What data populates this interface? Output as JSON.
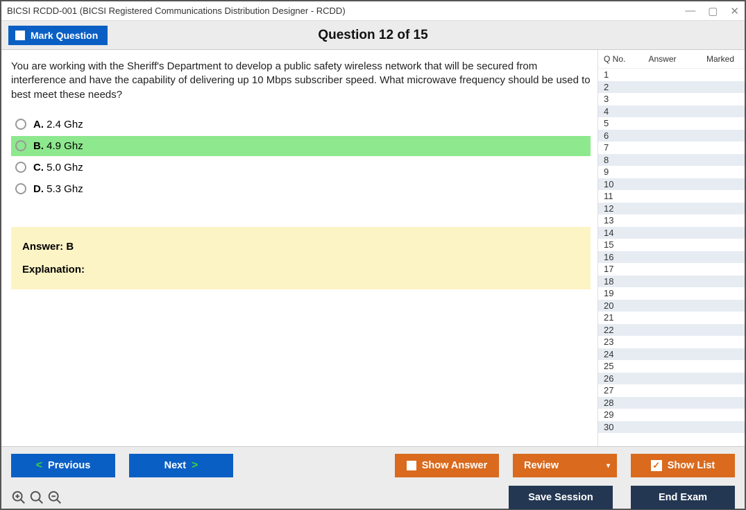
{
  "window": {
    "title": "BICSI RCDD-001 (BICSI Registered Communications Distribution Designer - RCDD)"
  },
  "header": {
    "mark_label": "Mark Question",
    "title": "Question 12 of 15"
  },
  "question": {
    "text": "You are working with the Sheriff's Department to develop a public safety wireless network that will be secured from interference and have the capability of delivering up 10 Mbps subscriber speed. What microwave frequency should be used to best meet these needs?",
    "options": [
      {
        "letter": "A.",
        "text": "2.4 Ghz",
        "correct": false
      },
      {
        "letter": "B.",
        "text": "4.9 Ghz",
        "correct": true
      },
      {
        "letter": "C.",
        "text": "5.0 Ghz",
        "correct": false
      },
      {
        "letter": "D.",
        "text": "5.3 Ghz",
        "correct": false
      }
    ]
  },
  "answer": {
    "label": "Answer: B",
    "explanation_label": "Explanation:"
  },
  "side": {
    "col1": "Q No.",
    "col2": "Answer",
    "col3": "Marked",
    "rows": [
      1,
      2,
      3,
      4,
      5,
      6,
      7,
      8,
      9,
      10,
      11,
      12,
      13,
      14,
      15,
      16,
      17,
      18,
      19,
      20,
      21,
      22,
      23,
      24,
      25,
      26,
      27,
      28,
      29,
      30
    ]
  },
  "footer": {
    "previous": "Previous",
    "next": "Next",
    "show_answer": "Show Answer",
    "review": "Review",
    "show_list": "Show List",
    "save_session": "Save Session",
    "end_exam": "End Exam"
  }
}
